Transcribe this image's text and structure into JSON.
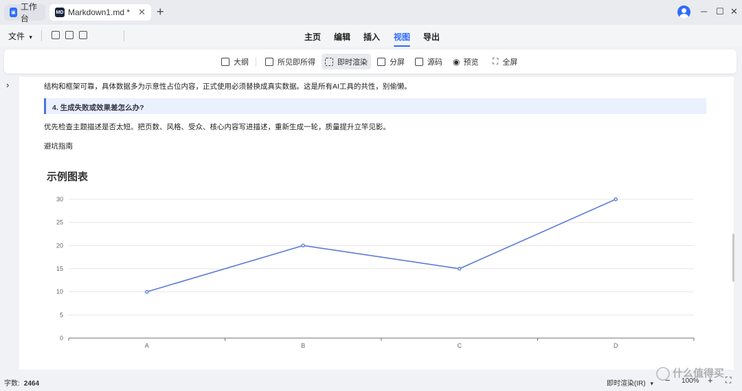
{
  "tabs": [
    {
      "label": "工作台",
      "icon": "app-logo-icon"
    },
    {
      "label": "Markdown1.md *",
      "icon": "md-file-icon",
      "icon_text": "MD"
    }
  ],
  "menubar": {
    "file_label": "文件",
    "items": [
      "主页",
      "编辑",
      "插入",
      "视图",
      "导出"
    ],
    "active": "视图"
  },
  "toolbar": {
    "items": [
      {
        "label": "大纲",
        "icon": "outline-icon"
      },
      {
        "label": "所见即所得",
        "icon": "wysiwyg-icon"
      },
      {
        "label": "即时渲染",
        "icon": "instant-render-icon",
        "active": true
      },
      {
        "label": "分屏",
        "icon": "split-screen-icon"
      },
      {
        "label": "源码",
        "icon": "source-code-icon"
      },
      {
        "label": "预览",
        "icon": "eye-icon"
      },
      {
        "label": "全屏",
        "icon": "fullscreen-icon"
      }
    ]
  },
  "content": {
    "line1": "结构和框架可靠，具体数据多为示意性占位内容，正式使用必须替换成真实数据。这是所有AI工具的共性，别偷懒。",
    "quote": "4. 生成失败或效果差怎么办?",
    "line2": "优先检查主题描述是否太短。把页数、风格、受众、核心内容写进描述，重新生成一轮，质量提升立竿见影。",
    "line3": "避坑指南"
  },
  "chart_data": {
    "type": "line",
    "title": "示例图表",
    "categories": [
      "A",
      "B",
      "C",
      "D"
    ],
    "values": [
      10,
      20,
      15,
      30
    ],
    "ylim": [
      0,
      30
    ],
    "yticks": [
      0,
      5,
      10,
      15,
      20,
      25,
      30
    ],
    "grid": true,
    "line_color": "#5b7bd5"
  },
  "statusbar": {
    "wordcount_label": "字数:",
    "wordcount_value": "2464",
    "mode": "即时渲染(IR)",
    "zoom": "100%"
  },
  "watermark": "什么值得买"
}
